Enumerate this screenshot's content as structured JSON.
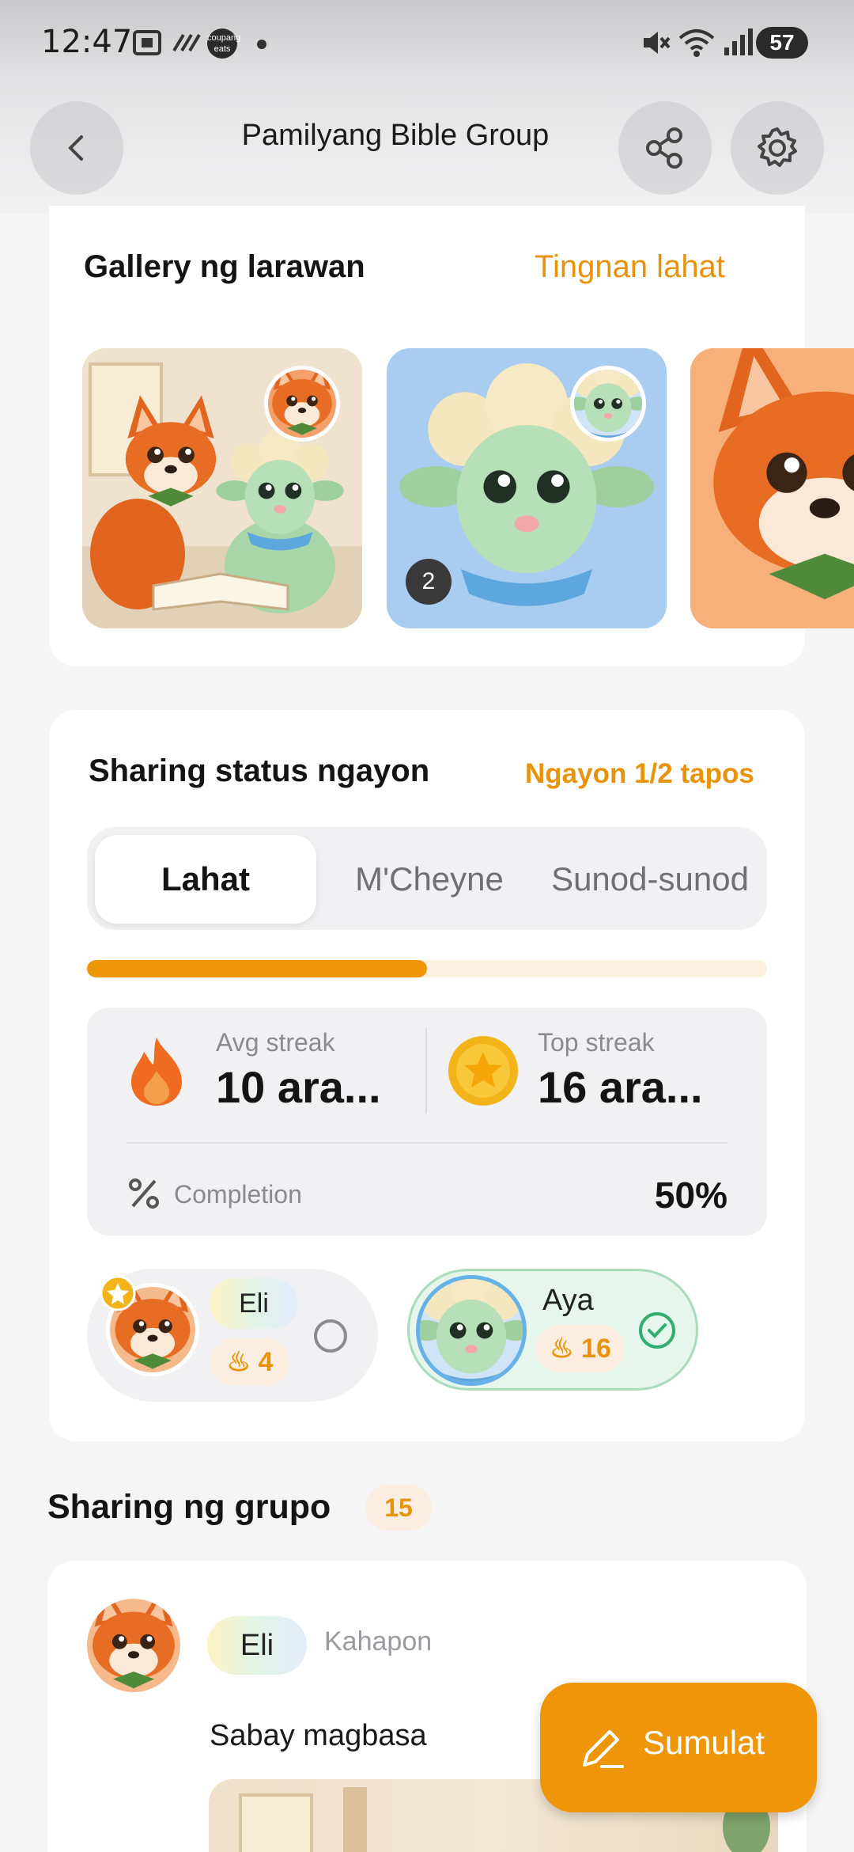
{
  "status_bar": {
    "time": "12:47",
    "notification_label": "coupang eats",
    "battery": "57",
    "icons": [
      "screen-record-icon",
      "link-icon",
      "app-badge-icon",
      "dot-icon",
      "mute-icon",
      "wifi-icon",
      "signal-icon",
      "battery-icon"
    ]
  },
  "header": {
    "title": "Pamilyang Bible Group",
    "icons": [
      "back-arrow-icon",
      "share-icon",
      "gear-icon"
    ]
  },
  "gallery": {
    "title": "Gallery ng larawan",
    "view_all": "Tingnan lahat",
    "second_tile_count": "2"
  },
  "sharing_status": {
    "title": "Sharing status ngayon",
    "today_summary": "Ngayon 1/2 tapos",
    "tabs": [
      {
        "label": "Lahat",
        "active": true
      },
      {
        "label": "M'Cheyne",
        "active": false
      },
      {
        "label": "Sunod-sunod",
        "active": false
      }
    ],
    "progress": 0.5,
    "avg_streak_label": "Avg streak",
    "avg_streak_value": "10 ara...",
    "top_streak_label": "Top streak",
    "top_streak_value": "16 ara...",
    "completion_label": "Completion",
    "completion_value": "50%",
    "members": [
      {
        "name": "Eli",
        "streak": "4",
        "done": false,
        "leader": true
      },
      {
        "name": "Aya",
        "streak": "16",
        "done": true,
        "leader": false
      }
    ]
  },
  "group_sharing": {
    "title": "Sharing ng grupo",
    "count": "15",
    "post": {
      "author": "Eli",
      "time": "Kahapon",
      "text": "Sabay magbasa"
    }
  },
  "fab": {
    "label": "Sumulat"
  },
  "colors": {
    "accent": "#ee9508",
    "link": "#e8930b",
    "done_green": "#2fae6d"
  }
}
